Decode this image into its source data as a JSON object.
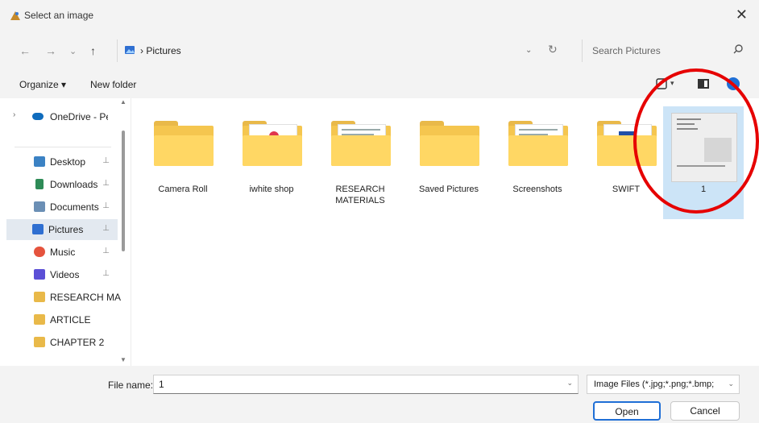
{
  "window": {
    "title": "Select an image",
    "close_glyph": "✕"
  },
  "nav": {
    "back": "←",
    "forward": "→",
    "recent": "⌄",
    "up": "↑",
    "refresh": "↻",
    "dropdown": "⌄"
  },
  "address": {
    "path": "› Pictures"
  },
  "search": {
    "placeholder": "Search Pictures"
  },
  "commands": {
    "organize": "Organize ▾",
    "new_folder": "New folder",
    "view_chevron": "▾"
  },
  "sidebar": {
    "items": [
      {
        "label": "OneDrive - Pers",
        "icon": "cloud-icon",
        "color": "#0f6cbd"
      },
      {
        "label": "Desktop",
        "icon": "desktop-icon",
        "color": "#3b82c4"
      },
      {
        "label": "Downloads",
        "icon": "download-icon",
        "color": "#2e8b57"
      },
      {
        "label": "Documents",
        "icon": "documents-icon",
        "color": "#6b8fb5"
      },
      {
        "label": "Pictures",
        "icon": "pictures-icon",
        "color": "#2f6fd1"
      },
      {
        "label": "Music",
        "icon": "music-icon",
        "color": "#e5533d"
      },
      {
        "label": "Videos",
        "icon": "videos-icon",
        "color": "#5b4fd6"
      },
      {
        "label": "RESEARCH MA",
        "icon": "folder-icon",
        "color": "#e9b949"
      },
      {
        "label": "ARTICLE",
        "icon": "folder-icon",
        "color": "#e9b949"
      },
      {
        "label": "CHAPTER 2",
        "icon": "folder-icon",
        "color": "#e9b949"
      }
    ],
    "pin_glyph": "📌",
    "expander_glyph": "›",
    "scroll_up": "▲",
    "scroll_down": "▼"
  },
  "files": [
    {
      "label": "Camera Roll",
      "type": "folder",
      "preview": "none"
    },
    {
      "label": "iwhite shop",
      "type": "folder",
      "preview": "pink"
    },
    {
      "label": "RESEARCH MATERIALS",
      "type": "folder",
      "preview": "doc"
    },
    {
      "label": "Saved Pictures",
      "type": "folder",
      "preview": "none"
    },
    {
      "label": "Screenshots",
      "type": "folder",
      "preview": "doc"
    },
    {
      "label": "SWIFT",
      "type": "folder",
      "preview": "blue"
    },
    {
      "label": "1",
      "type": "image",
      "preview": "scan"
    }
  ],
  "bottom": {
    "file_name_label": "File name:",
    "file_name_value": "1",
    "filter_value": "Image Files (*.jpg;*.png;*.bmp;",
    "open_label": "Open",
    "cancel_label": "Cancel",
    "dropdown": "⌄"
  },
  "colors": {
    "accent": "#1f6fd6",
    "highlight": "#e60000",
    "selected_bg": "#cce4f7"
  }
}
